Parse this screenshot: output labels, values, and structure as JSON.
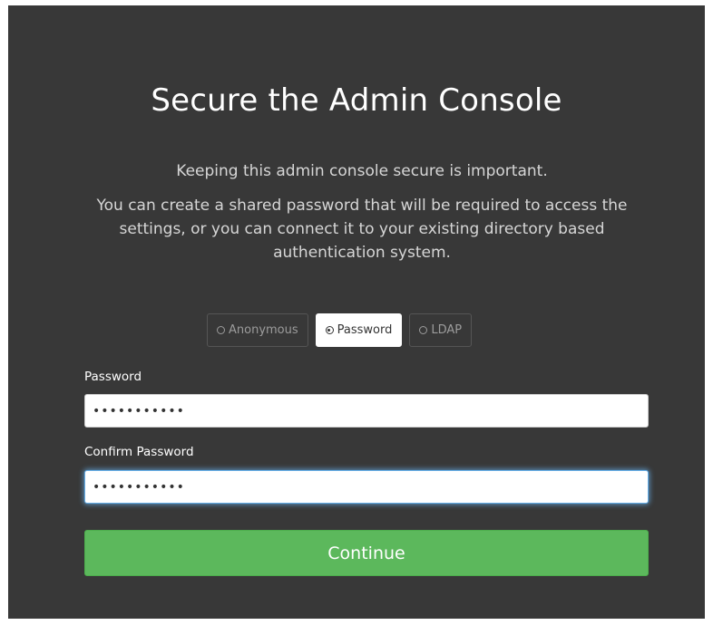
{
  "page": {
    "title": "Secure the Admin Console",
    "intro": "Keeping this admin console secure is important.",
    "description": "You can create a shared password that will be required to access the settings, or you can connect it to your existing directory based authentication system."
  },
  "auth_modes": [
    {
      "label": "Anonymous",
      "selected": false
    },
    {
      "label": "Password",
      "selected": true
    },
    {
      "label": "LDAP",
      "selected": false
    }
  ],
  "form": {
    "password_label": "Password",
    "password_value": "•••••••••••",
    "confirm_label": "Confirm Password",
    "confirm_value": "•••••••••••",
    "continue_label": "Continue"
  },
  "colors": {
    "panel_background": "#383838",
    "primary_button": "#5cb85c",
    "focus_glow": "#66afe9"
  }
}
